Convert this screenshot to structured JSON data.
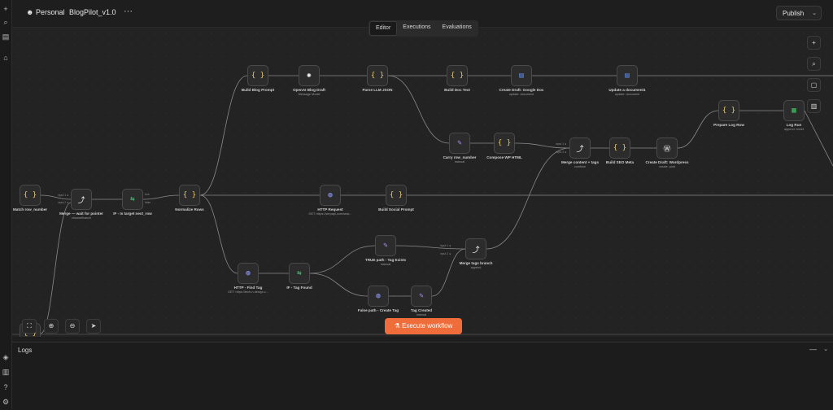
{
  "rail": {
    "items": [
      {
        "name": "plus-icon",
        "glyph": "+"
      },
      {
        "name": "search-icon",
        "glyph": "⌕"
      },
      {
        "name": "panel-toggle-icon",
        "glyph": "▤"
      },
      {
        "name": "home-icon",
        "glyph": "⌂"
      }
    ],
    "bottom": [
      {
        "name": "templates-icon",
        "glyph": "◈"
      },
      {
        "name": "insights-icon",
        "glyph": "▥"
      },
      {
        "name": "help-icon",
        "glyph": "?"
      },
      {
        "name": "settings-icon",
        "glyph": "⚙"
      }
    ]
  },
  "header": {
    "project": "Personal",
    "workflow_name": "BlogPilot_v1.0",
    "more": "···",
    "publish": "Publish"
  },
  "tabs": [
    "Editor",
    "Executions",
    "Evaluations"
  ],
  "canvas_tools": {
    "zoom_to_fit": "⛶",
    "zoom_in": "⊕",
    "zoom_out": "⊖",
    "tidy": "➤",
    "right": [
      "+",
      "⌕",
      "▢",
      "▥"
    ]
  },
  "execute_label": "Execute workflow",
  "logs": {
    "title": "Logs",
    "minimize": "—",
    "collapse": "⌄"
  },
  "nodes": [
    {
      "id": "match",
      "label": "Match row_number",
      "sub": "",
      "glyph": "{ }",
      "color": "#e8c97a"
    },
    {
      "id": "merge_wait",
      "label": "Merge — wait for pointer",
      "sub": "chooseBranch",
      "glyph": "⤴",
      "color": "#ffffff"
    },
    {
      "id": "if_target",
      "label": "IF - Is target next_row",
      "sub": "",
      "glyph": "⇆",
      "color": "#4ec97a"
    },
    {
      "id": "normalize",
      "label": "Normalize Rows",
      "sub": "",
      "glyph": "{ }",
      "color": "#e8c97a"
    },
    {
      "id": "build_blog",
      "label": "Build Blog Prompt",
      "sub": "",
      "glyph": "{ }",
      "color": "#e8c97a"
    },
    {
      "id": "openai",
      "label": "OpenAI Blog Draft",
      "sub": "Message Model",
      "glyph": "✺",
      "color": "#ffffff"
    },
    {
      "id": "parse_llm",
      "label": "Parse LLM JSON",
      "sub": "",
      "glyph": "{ }",
      "color": "#e8c97a"
    },
    {
      "id": "build_doc",
      "label": "Build Doc Text",
      "sub": "",
      "glyph": "{ }",
      "color": "#e8c97a"
    },
    {
      "id": "create_gdoc",
      "label": "Create Draft: Google Doc",
      "sub": "update: document",
      "glyph": "▤",
      "color": "#5b8def"
    },
    {
      "id": "update_doc",
      "label": "Update a document1",
      "sub": "update: document",
      "glyph": "▤",
      "color": "#5b8def"
    },
    {
      "id": "carry_row",
      "label": "Carry row_number",
      "sub": "manual",
      "glyph": "✎",
      "color": "#b08cf0"
    },
    {
      "id": "compose_wp",
      "label": "Compose WP HTML",
      "sub": "",
      "glyph": "{ }",
      "color": "#e8c97a"
    },
    {
      "id": "merge_content",
      "label": "Merge content + tags",
      "sub": "combine",
      "glyph": "⤴",
      "color": "#ffffff"
    },
    {
      "id": "build_seo",
      "label": "Build SEO Meta",
      "sub": "",
      "glyph": "{ }",
      "color": "#e8c97a"
    },
    {
      "id": "create_wp",
      "label": "Create Draft: Wordpress",
      "sub": "create: post",
      "glyph": "Ⓦ",
      "color": "#ffffff"
    },
    {
      "id": "prepare_log",
      "label": "Prepare Log Row",
      "sub": "",
      "glyph": "{ }",
      "color": "#e8c97a"
    },
    {
      "id": "log_run",
      "label": "Log Run",
      "sub": "append: sheet",
      "glyph": "▦",
      "color": "#3fbf5f"
    },
    {
      "id": "http_request",
      "label": "HTTP Request",
      "sub": "GET: https://serpapi.com/sear...",
      "glyph": "◍",
      "color": "#8f9cff"
    },
    {
      "id": "build_social",
      "label": "Build Social Prompt",
      "sub": "",
      "glyph": "{ }",
      "color": "#e8c97a"
    },
    {
      "id": "true_path",
      "label": "TRUE path - Tag Exists",
      "sub": "manual",
      "glyph": "✎",
      "color": "#b08cf0"
    },
    {
      "id": "merge_tags",
      "label": "Merge tags branch",
      "sub": "append",
      "glyph": "⤴",
      "color": "#ffffff"
    },
    {
      "id": "http_find",
      "label": "HTTP - Find Tag",
      "sub": "GET: https://tech-n-design.c...",
      "glyph": "◍",
      "color": "#8f9cff"
    },
    {
      "id": "if_tag",
      "label": "IF - Tag Found",
      "sub": "",
      "glyph": "⇆",
      "color": "#4ec97a"
    },
    {
      "id": "false_path",
      "label": "False path - Create Tag",
      "sub": "",
      "glyph": "◍",
      "color": "#8f9cff"
    },
    {
      "id": "tag_created",
      "label": "Tag Created",
      "sub": "manual",
      "glyph": "✎",
      "color": "#b08cf0"
    },
    {
      "id": "bottom_code",
      "label": "",
      "sub": "",
      "glyph": "{ }",
      "color": "#e8c97a"
    }
  ],
  "port_labels": {
    "in1": "input 1 ●",
    "in2": "input 2 ●",
    "true": "true",
    "false": "false"
  }
}
